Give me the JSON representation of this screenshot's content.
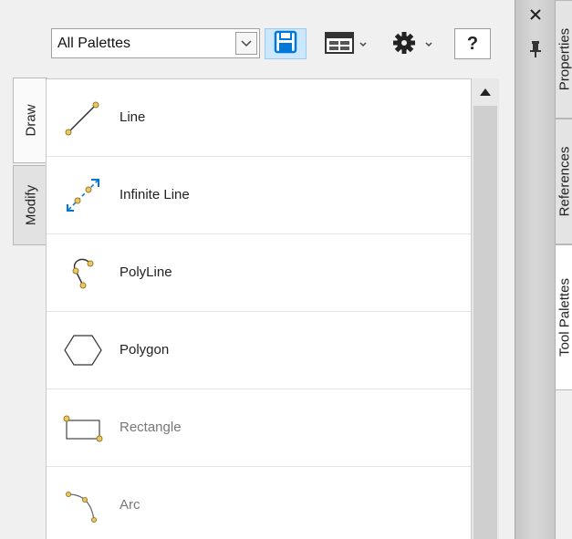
{
  "toolbar": {
    "dropdown_value": "All Palettes",
    "help_label": "?"
  },
  "side_tabs": [
    {
      "label": "Draw",
      "active": true
    },
    {
      "label": "Modify",
      "active": false
    }
  ],
  "tools": [
    {
      "label": "Line",
      "icon": "line-icon"
    },
    {
      "label": "Infinite Line",
      "icon": "infinite-line-icon"
    },
    {
      "label": "PolyLine",
      "icon": "polyline-icon"
    },
    {
      "label": "Polygon",
      "icon": "polygon-icon"
    },
    {
      "label": "Rectangle",
      "icon": "rectangle-icon"
    },
    {
      "label": "Arc",
      "icon": "arc-icon"
    }
  ],
  "title_strip": {
    "close_glyph": "×"
  },
  "right_tabs": [
    {
      "label": "Properties"
    },
    {
      "label": "References"
    },
    {
      "label": "Tool Palettes",
      "active": true
    }
  ],
  "colors": {
    "accent": "#0078d7",
    "node": "#e8c96a",
    "node_stroke": "#9a7a20"
  }
}
